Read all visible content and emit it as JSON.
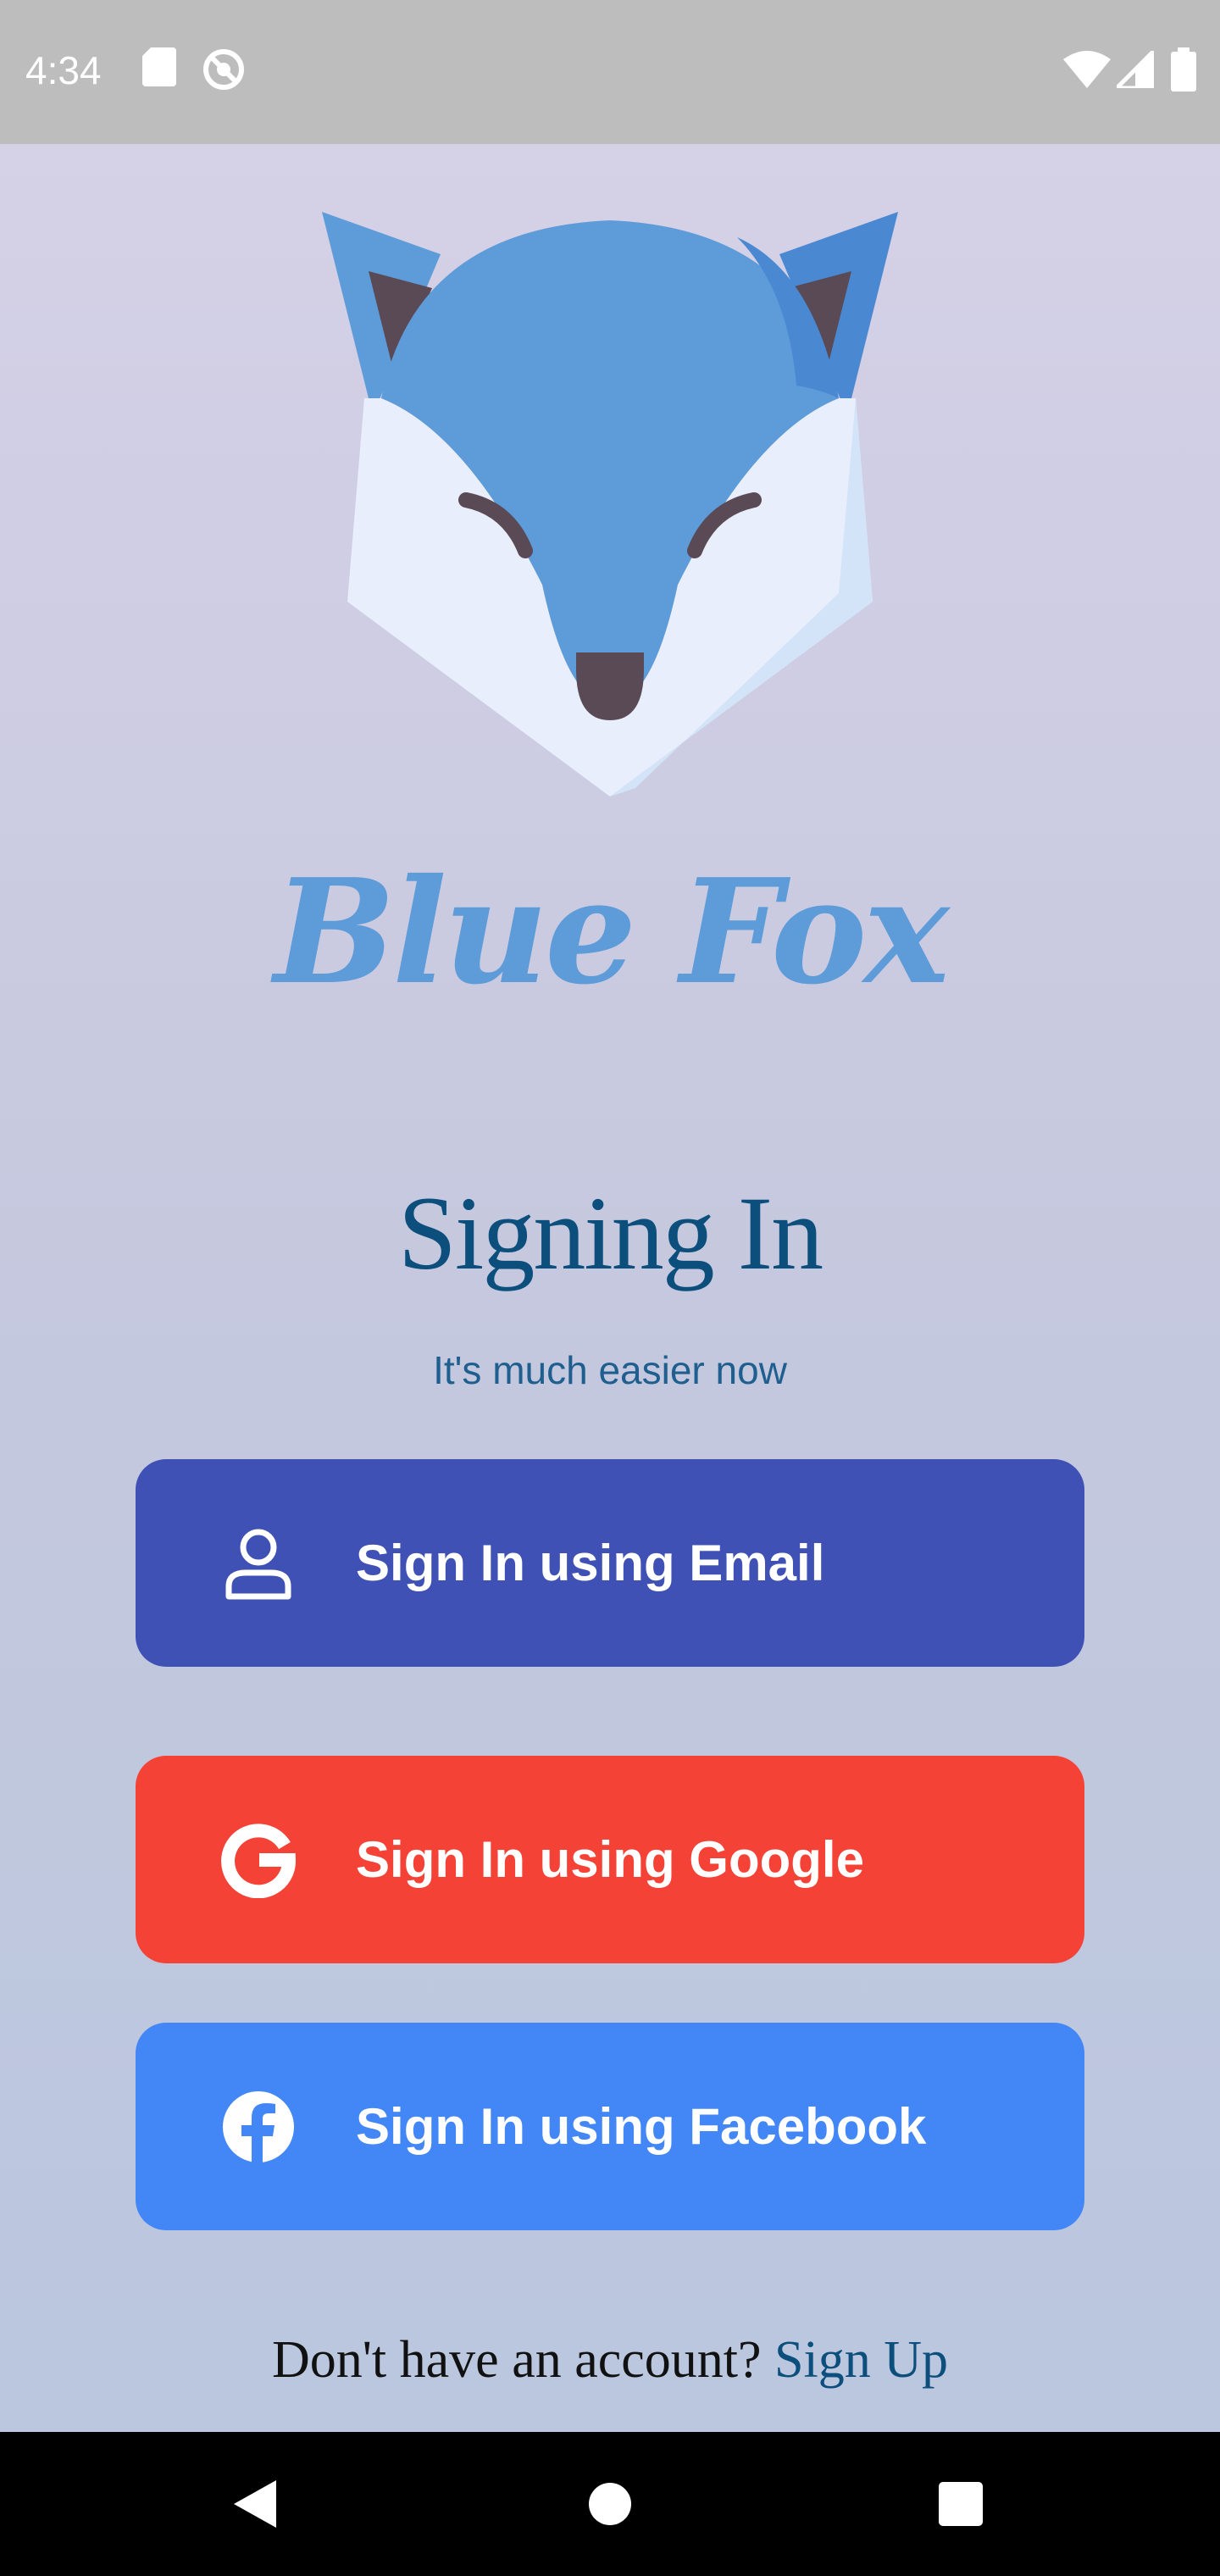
{
  "status_bar": {
    "time": "4:34",
    "left_icons": [
      "sd-card-icon",
      "no-disturb-icon"
    ],
    "right_icons": [
      "wifi-icon",
      "signal-icon",
      "battery-icon"
    ]
  },
  "brand": {
    "name": "Blue Fox",
    "logo": "fox-head-logo",
    "color": "#5e9bd9"
  },
  "header": {
    "title": "Signing In",
    "subtitle": "It's much easier now"
  },
  "buttons": {
    "email": {
      "label": "Sign In using Email",
      "icon": "user-icon",
      "color": "#3f51b5"
    },
    "google": {
      "label": "Sign In using Google",
      "icon": "google-icon",
      "color": "#f44336"
    },
    "facebook": {
      "label": "Sign In using Facebook",
      "icon": "facebook-icon",
      "color": "#4287f5"
    }
  },
  "footer": {
    "prompt": "Don't have an account?",
    "link": "Sign Up"
  },
  "nav_bar": {
    "icons": [
      "back-icon",
      "home-icon",
      "recents-icon"
    ]
  }
}
